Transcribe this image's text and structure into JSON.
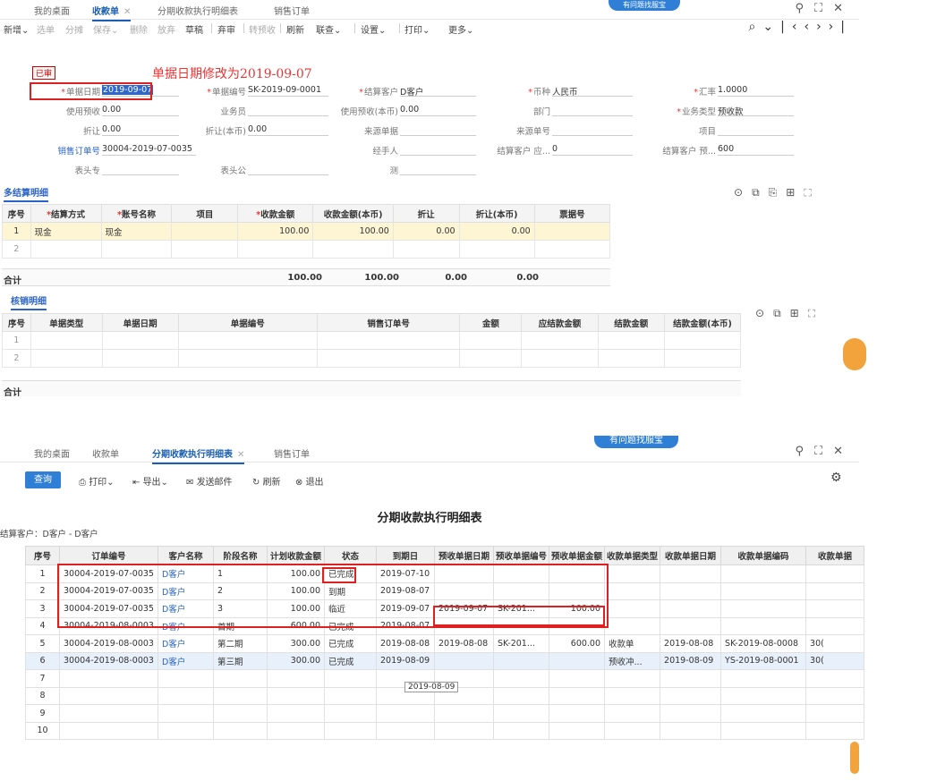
{
  "top": {
    "tabs": [
      {
        "label": "我的桌面"
      },
      {
        "label": "收款单"
      },
      {
        "label": "分期收款执行明细表"
      },
      {
        "label": "销售订单"
      }
    ],
    "toolbar": [
      "新增⌄",
      "选单",
      "分摊",
      "保存⌄",
      "删除",
      "放弃",
      "草稿",
      "弃审",
      "转预收",
      "刷新",
      "联查⌄",
      "设置⌄",
      "打印⌄",
      "更多⌄"
    ],
    "status_tag": "已审",
    "annotation": "单据日期修改为2019-09-07",
    "form": {
      "doc_date_label": "单据日期",
      "doc_date": "2019-09-07",
      "doc_no_label": "单据编号",
      "doc_no": "SK-2019-09-0001",
      "cust_label": "结算客户",
      "cust": "D客户",
      "currency_label": "币种",
      "currency": "人民币",
      "rate_label": "汇率",
      "rate": "1.0000",
      "use_prepay_label": "使用预收",
      "use_prepay": "0.00",
      "dept_label": "业务员",
      "dept": "",
      "use_prepay_base_label": "使用预收(本币)",
      "use_prepay_base": "0.00",
      "bumen_label": "部门",
      "bumen": "",
      "biz_type_label": "业务类型",
      "biz_type": "预收款",
      "discount_label": "折让",
      "discount": "0.00",
      "discount_base_label": "折让(本币)",
      "discount_base": "0.00",
      "src_doc_label": "来源单据",
      "src_doc": "",
      "src_no_label": "来源单号",
      "src_no": "",
      "project_label": "项目",
      "project": "",
      "so_label": "销售订单号",
      "so": "30004-2019-07-0035",
      "handler_label": "经手人",
      "handler": "",
      "cust_recv_label": "结算客户 应...",
      "cust_recv": "0",
      "cust_pre_label": "结算客户 预...",
      "cust_pre": "600",
      "head1_label": "表头专",
      "head2_label": "表头公",
      "head3_label": "测"
    },
    "settle_section": "多结算明细",
    "settle_headers": [
      "序号",
      "结算方式",
      "账号名称",
      "项目",
      "收款金额",
      "收款金额(本币)",
      "折让",
      "折让(本币)",
      "票据号"
    ],
    "settle_rows": [
      [
        "1",
        "现金",
        "现金",
        "",
        "100.00",
        "100.00",
        "0.00",
        "0.00",
        ""
      ],
      [
        "2",
        "",
        "",
        "",
        "",
        "",
        "",
        "",
        ""
      ]
    ],
    "settle_sum": {
      "label": "合计",
      "amount": "100.00",
      "amount_base": "100.00",
      "disc": "0.00",
      "disc_base": "0.00"
    },
    "verify_section": "核销明细",
    "verify_headers": [
      "序号",
      "单据类型",
      "单据日期",
      "单据编号",
      "销售订单号",
      "金额",
      "应结款金额",
      "结款金额",
      "结款金额(本币)"
    ],
    "verify_rows": [
      [
        "1",
        "",
        "",
        "",
        "",
        "",
        "",
        "",
        ""
      ],
      [
        "2",
        "",
        "",
        "",
        "",
        "",
        "",
        "",
        ""
      ]
    ],
    "verify_sum_label": "合计",
    "help_text": "有问题找服宝"
  },
  "bottom": {
    "tabs": [
      {
        "label": "我的桌面"
      },
      {
        "label": "收款单"
      },
      {
        "label": "分期收款执行明细表"
      },
      {
        "label": "销售订单"
      }
    ],
    "help_text": "有问题找服宝",
    "toolbar": {
      "query": "查询",
      "print": "打印⌄",
      "export": "导出⌄",
      "email": "发送邮件",
      "refresh": "刷新",
      "exit": "退出"
    },
    "title": "分期收款执行明细表",
    "customer_line": "结算客户：D客户 - D客户",
    "headers": [
      "序号",
      "订单编号",
      "客户名称",
      "阶段名称",
      "计划收款金额",
      "状态",
      "到期日",
      "预收单据日期",
      "预收单据编号",
      "预收单据金额",
      "收款单据类型",
      "收款单据日期",
      "收款单据编码",
      "收款单据"
    ],
    "rows": [
      [
        "1",
        "30004-2019-07-0035",
        "D客户",
        "1",
        "100.00",
        "已完成",
        "2019-07-10",
        "",
        "",
        "",
        "",
        "",
        "",
        ""
      ],
      [
        "2",
        "30004-2019-07-0035",
        "D客户",
        "2",
        "100.00",
        "到期",
        "2019-08-07",
        "",
        "",
        "",
        "",
        "",
        "",
        ""
      ],
      [
        "3",
        "30004-2019-07-0035",
        "D客户",
        "3",
        "100.00",
        "临近",
        "2019-09-07",
        "2019-09-07",
        "SK-201...",
        "100.00",
        "",
        "",
        "",
        ""
      ],
      [
        "4",
        "30004-2019-08-0003",
        "D客户",
        "首期",
        "600.00",
        "已完成",
        "2019-08-07",
        "",
        "",
        "",
        "",
        "",
        "",
        ""
      ],
      [
        "5",
        "30004-2019-08-0003",
        "D客户",
        "第二期",
        "300.00",
        "已完成",
        "2019-08-08",
        "2019-08-08",
        "SK-201...",
        "600.00",
        "收款单",
        "2019-08-08",
        "SK-2019-08-0008",
        "30("
      ],
      [
        "6",
        "30004-2019-08-0003",
        "D客户",
        "第三期",
        "300.00",
        "已完成",
        "2019-08-09",
        "",
        "",
        "",
        "预收冲...",
        "2019-08-09",
        "YS-2019-08-0001",
        "30("
      ],
      [
        "7",
        "",
        "",
        "",
        "",
        "",
        "",
        "",
        "",
        "",
        "",
        "",
        "",
        ""
      ],
      [
        "8",
        "",
        "",
        "",
        "",
        "",
        "",
        "",
        "",
        "",
        "",
        "",
        "",
        ""
      ],
      [
        "9",
        "",
        "",
        "",
        "",
        "",
        "",
        "",
        "",
        "",
        "",
        "",
        "",
        ""
      ],
      [
        "10",
        "",
        "",
        "",
        "",
        "",
        "",
        "",
        "",
        "",
        "",
        "",
        "",
        ""
      ]
    ],
    "tooltip": "2019-08-09"
  }
}
